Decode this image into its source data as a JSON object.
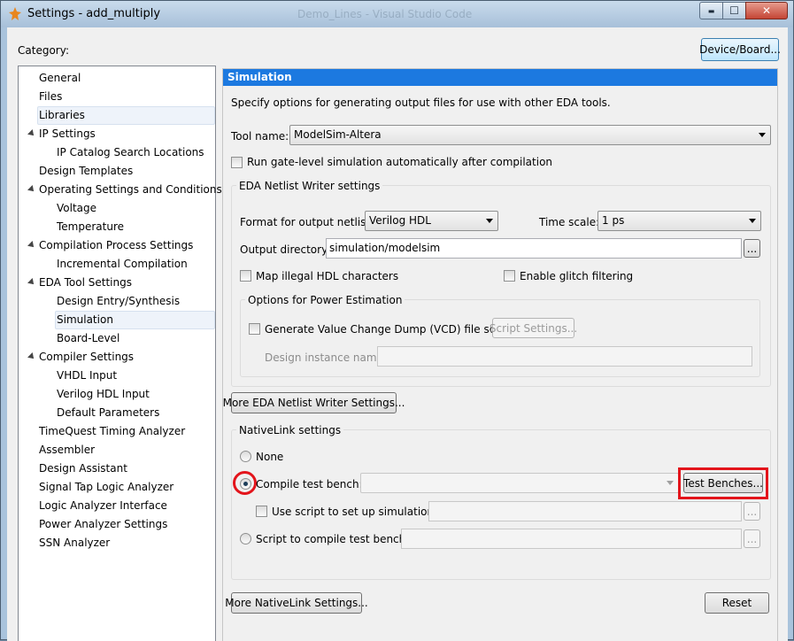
{
  "window": {
    "title": "Settings - add_multiply",
    "background_title": "Demo_Lines - Visual Studio Code",
    "controls": {
      "minimize": "▬",
      "maximize": "☐",
      "close": "✕"
    }
  },
  "header": {
    "category_label": "Category:",
    "device_board_button": "Device/Board..."
  },
  "tree": {
    "items": [
      {
        "label": "General",
        "level": 0,
        "expandable": false
      },
      {
        "label": "Files",
        "level": 0,
        "expandable": false
      },
      {
        "label": "Libraries",
        "level": 0,
        "expandable": false,
        "selected": true
      },
      {
        "label": "IP Settings",
        "level": 0,
        "expandable": true
      },
      {
        "label": "IP Catalog Search Locations",
        "level": 1,
        "expandable": false
      },
      {
        "label": "Design Templates",
        "level": 0,
        "expandable": false
      },
      {
        "label": "Operating Settings and Conditions",
        "level": 0,
        "expandable": true
      },
      {
        "label": "Voltage",
        "level": 1,
        "expandable": false
      },
      {
        "label": "Temperature",
        "level": 1,
        "expandable": false
      },
      {
        "label": "Compilation Process Settings",
        "level": 0,
        "expandable": true
      },
      {
        "label": "Incremental Compilation",
        "level": 1,
        "expandable": false
      },
      {
        "label": "EDA Tool Settings",
        "level": 0,
        "expandable": true
      },
      {
        "label": "Design Entry/Synthesis",
        "level": 1,
        "expandable": false
      },
      {
        "label": "Simulation",
        "level": 1,
        "expandable": false,
        "selected": true
      },
      {
        "label": "Board-Level",
        "level": 1,
        "expandable": false
      },
      {
        "label": "Compiler Settings",
        "level": 0,
        "expandable": true
      },
      {
        "label": "VHDL Input",
        "level": 1,
        "expandable": false
      },
      {
        "label": "Verilog HDL Input",
        "level": 1,
        "expandable": false
      },
      {
        "label": "Default Parameters",
        "level": 1,
        "expandable": false
      },
      {
        "label": "TimeQuest Timing Analyzer",
        "level": 0,
        "expandable": false
      },
      {
        "label": "Assembler",
        "level": 0,
        "expandable": false
      },
      {
        "label": "Design Assistant",
        "level": 0,
        "expandable": false
      },
      {
        "label": "Signal Tap Logic Analyzer",
        "level": 0,
        "expandable": false
      },
      {
        "label": "Logic Analyzer Interface",
        "level": 0,
        "expandable": false
      },
      {
        "label": "Power Analyzer Settings",
        "level": 0,
        "expandable": false
      },
      {
        "label": "SSN Analyzer",
        "level": 0,
        "expandable": false
      }
    ]
  },
  "panel": {
    "title": "Simulation",
    "description": "Specify options for generating output files for use with other EDA tools.",
    "tool_name_label": "Tool name:",
    "tool_name_value": "ModelSim-Altera",
    "run_gate_level_label": "Run gate-level simulation automatically after compilation",
    "run_gate_level_checked": false,
    "netlist": {
      "group_title": "EDA Netlist Writer settings",
      "format_label": "Format for output netlist:",
      "format_value": "Verilog HDL",
      "time_scale_label": "Time scale:",
      "time_scale_value": "1 ps",
      "output_dir_label": "Output directory:",
      "output_dir_value": "simulation/modelsim",
      "browse_label": "...",
      "map_illegal_label": "Map illegal HDL characters",
      "map_illegal_checked": false,
      "glitch_label": "Enable glitch filtering",
      "glitch_checked": false,
      "power": {
        "group_title": "Options for Power Estimation",
        "vcd_label": "Generate Value Change Dump (VCD) file script",
        "vcd_checked": false,
        "script_settings_label": "Script Settings...",
        "design_instance_label": "Design instance name:",
        "design_instance_value": ""
      }
    },
    "more_netlist_button": "More EDA Netlist Writer Settings...",
    "nativelink": {
      "group_title": "NativeLink settings",
      "none_label": "None",
      "compile_tb_label": "Compile test bench:",
      "compile_tb_value": "",
      "test_benches_button": "Test Benches...",
      "use_script_label": "Use script to set up simulation:",
      "use_script_checked": false,
      "use_script_value": "",
      "script_compile_label": "Script to compile test bench:",
      "script_compile_value": "",
      "browse_label": "...",
      "selected": "compile_tb"
    },
    "more_nativelink_button": "More NativeLink Settings...",
    "reset_button": "Reset"
  },
  "colors": {
    "header_blue": "#1c79e0",
    "highlight_red": "#e3141b"
  }
}
